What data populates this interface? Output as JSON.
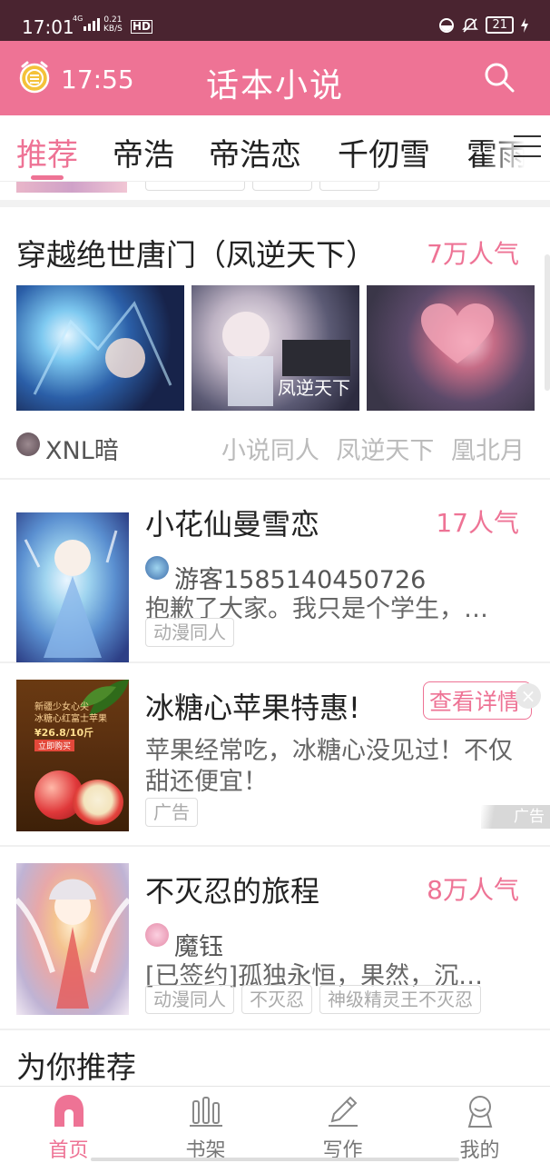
{
  "status_bar": {
    "time": "17:01",
    "network": "4G",
    "speed_value": "0.21",
    "speed_unit": "KB/S",
    "hd": "HD",
    "battery": "21"
  },
  "header": {
    "clock_time": "17:55",
    "title": "话本小说"
  },
  "tabs": [
    "推荐",
    "帝浩",
    "帝浩恋",
    "千仞雪",
    "霍雨"
  ],
  "featured": {
    "title": "穿越绝世唐门（凤逆天下）",
    "popularity": "7万人气",
    "image_caption": "凤逆天下",
    "author": "XNL暗",
    "tags": "小说同人  凤逆天下  凰北月"
  },
  "cards": [
    {
      "title": "小花仙曼雪恋",
      "popularity": "17人气",
      "author": "游客1585140450726",
      "desc": "抱歉了大家。我只是个学生，…",
      "tags": [
        "动漫同人"
      ]
    },
    {
      "title": "冰糖心苹果特惠!",
      "detail_button": "查看详情",
      "desc_line1": "苹果经常吃，冰糖心没见过！不仅",
      "desc_line2": "甜还便宜！",
      "tags": [
        "广告"
      ],
      "ad_mark": "广告",
      "close": "×",
      "image_text_1": "新疆少女心尖",
      "image_text_2": "冰糖心红富士苹果",
      "image_price": "¥26.8/10斤",
      "image_button": "立即购买"
    },
    {
      "title": "不灭忍的旅程",
      "popularity": "8万人气",
      "author": "魔钰",
      "desc": "[已签约]孤独永恒，果然，沉…",
      "tags": [
        "动漫同人",
        "不灭忍",
        "神级精灵王不灭忍"
      ]
    }
  ],
  "section_title": "为你推荐",
  "bottom_nav": [
    {
      "label": "首页",
      "icon": "home-icon",
      "active": true
    },
    {
      "label": "书架",
      "icon": "bookshelf-icon",
      "active": false
    },
    {
      "label": "写作",
      "icon": "pencil-icon",
      "active": false
    },
    {
      "label": "我的",
      "icon": "user-icon",
      "active": false
    }
  ],
  "colors": {
    "accent": "#ee7395",
    "status_bar": "#4a2430"
  }
}
